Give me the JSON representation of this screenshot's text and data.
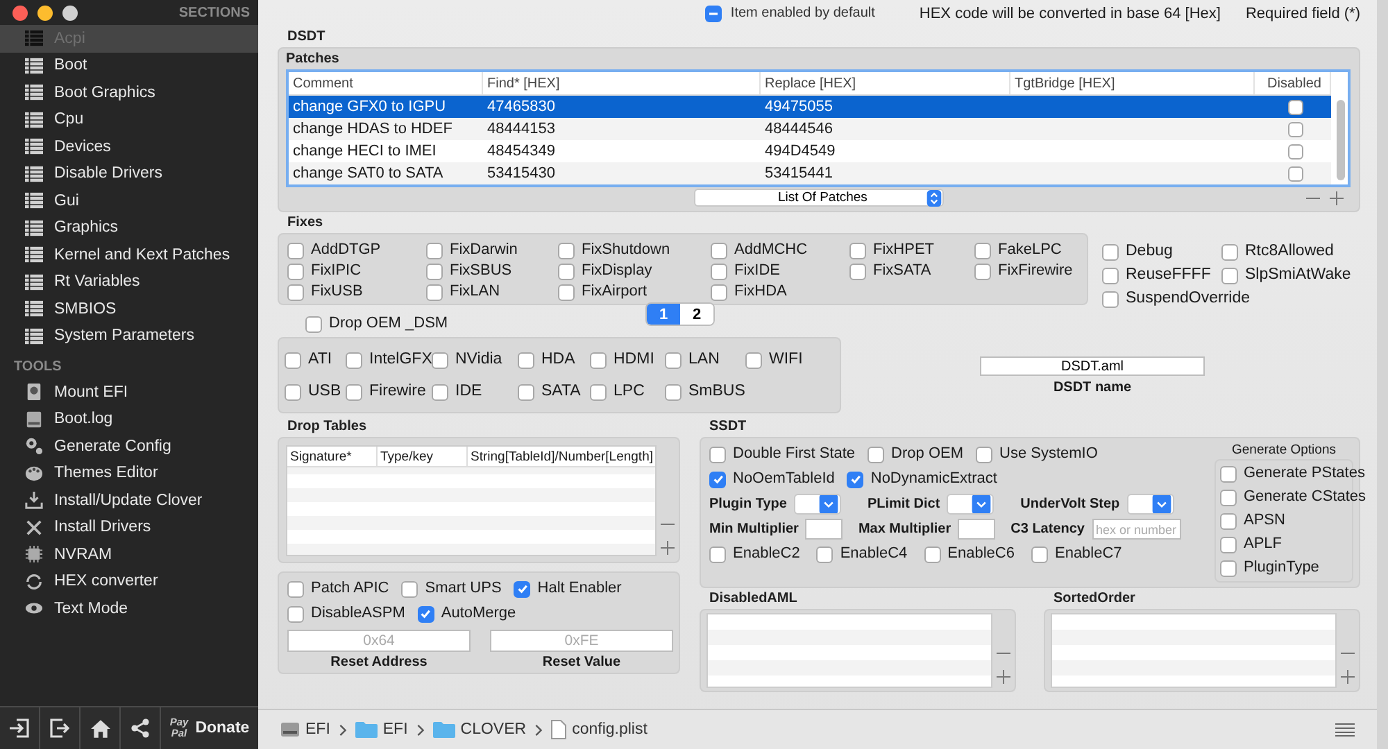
{
  "sidebar": {
    "sections_header": "SECTIONS",
    "sections": [
      {
        "label": "Acpi",
        "selected": true
      },
      {
        "label": "Boot",
        "selected": false
      },
      {
        "label": "Boot Graphics",
        "selected": false
      },
      {
        "label": "Cpu",
        "selected": false
      },
      {
        "label": "Devices",
        "selected": false
      },
      {
        "label": "Disable Drivers",
        "selected": false
      },
      {
        "label": "Gui",
        "selected": false
      },
      {
        "label": "Graphics",
        "selected": false
      },
      {
        "label": "Kernel and Kext Patches",
        "selected": false
      },
      {
        "label": "Rt Variables",
        "selected": false
      },
      {
        "label": "SMBIOS",
        "selected": false
      },
      {
        "label": "System Parameters",
        "selected": false
      }
    ],
    "tools_header": "TOOLS",
    "tools": [
      {
        "label": "Mount EFI"
      },
      {
        "label": "Boot.log"
      },
      {
        "label": "Generate Config"
      },
      {
        "label": "Themes Editor"
      },
      {
        "label": "Install/Update Clover"
      },
      {
        "label": "Install Drivers"
      },
      {
        "label": "NVRAM"
      },
      {
        "label": "HEX converter"
      },
      {
        "label": "Text Mode"
      }
    ],
    "donate": {
      "logo": [
        "Pay",
        "Pal"
      ],
      "label": "Donate"
    }
  },
  "header": {
    "legend": "Item enabled by default",
    "hex_note": "HEX code will be converted in base 64 [Hex]",
    "required_note": "Required field (*)"
  },
  "dsdt": {
    "title": "DSDT",
    "patches": {
      "title": "Patches",
      "columns": [
        "Comment",
        "Find* [HEX]",
        "Replace [HEX]",
        "TgtBridge [HEX]",
        "Disabled"
      ],
      "rows": [
        {
          "comment": "change GFX0 to IGPU",
          "find": "47465830",
          "replace": "49475055",
          "disabled": false,
          "selected": true
        },
        {
          "comment": "change HDAS to HDEF",
          "find": "48444153",
          "replace": "48444546",
          "disabled": false,
          "selected": false
        },
        {
          "comment": "change HECI to IMEI",
          "find": "48454349",
          "replace": "494D4549",
          "disabled": false,
          "selected": false
        },
        {
          "comment": "change SAT0 to SATA",
          "find": "53415430",
          "replace": "53415441",
          "disabled": false,
          "selected": false
        }
      ],
      "dropdown": "List Of Patches"
    },
    "fixes": {
      "title": "Fixes",
      "items": [
        {
          "label": "AddDTGP",
          "checked": false
        },
        {
          "label": "FixDarwin",
          "checked": false
        },
        {
          "label": "FixShutdown",
          "checked": false
        },
        {
          "label": "AddMCHC",
          "checked": false
        },
        {
          "label": "FixHPET",
          "checked": false
        },
        {
          "label": "FakeLPC",
          "checked": false
        },
        {
          "label": "FixIPIC",
          "checked": false
        },
        {
          "label": "FixSBUS",
          "checked": false
        },
        {
          "label": "FixDisplay",
          "checked": false
        },
        {
          "label": "FixIDE",
          "checked": false
        },
        {
          "label": "FixSATA",
          "checked": false
        },
        {
          "label": "FixFirewire",
          "checked": false
        },
        {
          "label": "FixUSB",
          "checked": false
        },
        {
          "label": "FixLAN",
          "checked": false
        },
        {
          "label": "FixAirport",
          "checked": false
        },
        {
          "label": "FixHDA",
          "checked": false
        }
      ],
      "pages": [
        {
          "label": "1",
          "selected": true
        },
        {
          "label": "2",
          "selected": false
        }
      ]
    },
    "options": [
      {
        "label": "Debug",
        "checked": false
      },
      {
        "label": "Rtc8Allowed",
        "checked": false
      },
      {
        "label": "ReuseFFFF",
        "checked": false
      },
      {
        "label": "SlpSmiAtWake",
        "checked": false
      },
      {
        "label": "SuspendOverride",
        "checked": false
      }
    ],
    "drop_oem_dsm": {
      "label": "Drop OEM _DSM",
      "checked": false
    },
    "devices": [
      {
        "label": "ATI",
        "checked": false
      },
      {
        "label": "IntelGFX",
        "checked": false
      },
      {
        "label": "NVidia",
        "checked": false
      },
      {
        "label": "HDA",
        "checked": false
      },
      {
        "label": "HDMI",
        "checked": false
      },
      {
        "label": "LAN",
        "checked": false
      },
      {
        "label": "WIFI",
        "checked": false
      },
      {
        "label": "USB",
        "checked": false
      },
      {
        "label": "Firewire",
        "checked": false
      },
      {
        "label": "IDE",
        "checked": false
      },
      {
        "label": "SATA",
        "checked": false
      },
      {
        "label": "LPC",
        "checked": false
      },
      {
        "label": "SmBUS",
        "checked": false
      }
    ],
    "dsdt_name": {
      "value": "DSDT.aml",
      "label": "DSDT name"
    }
  },
  "drop_tables": {
    "title": "Drop Tables",
    "columns": [
      "Signature*",
      "Type/key",
      "String[TableId]/Number[Length]"
    ]
  },
  "acpi_flags": [
    {
      "label": "Patch APIC",
      "checked": false
    },
    {
      "label": "Smart UPS",
      "checked": false
    },
    {
      "label": "Halt Enabler",
      "checked": true
    },
    {
      "label": "DisableASPM",
      "checked": false
    },
    {
      "label": "AutoMerge",
      "checked": true
    }
  ],
  "reset_address": {
    "placeholder": "0x64",
    "label": "Reset Address"
  },
  "reset_value": {
    "placeholder": "0xFE",
    "label": "Reset Value"
  },
  "ssdt": {
    "title": "SSDT",
    "flags": [
      {
        "label": "Double First State",
        "checked": false
      },
      {
        "label": "Drop OEM",
        "checked": false
      },
      {
        "label": "Use SystemIO",
        "checked": false
      },
      {
        "label": "NoOemTableId",
        "checked": true
      },
      {
        "label": "NoDynamicExtract",
        "checked": true
      }
    ],
    "dropdowns": [
      {
        "label": "Plugin Type"
      },
      {
        "label": "PLimit Dict"
      },
      {
        "label": "UnderVolt Step"
      }
    ],
    "min_multiplier": {
      "label": "Min Multiplier"
    },
    "max_multiplier": {
      "label": "Max Multiplier"
    },
    "c3_latency": {
      "label": "C3 Latency",
      "placeholder": "hex or number"
    },
    "enable": [
      {
        "label": "EnableC2",
        "checked": false
      },
      {
        "label": "EnableC4",
        "checked": false
      },
      {
        "label": "EnableC6",
        "checked": false
      },
      {
        "label": "EnableC7",
        "checked": false
      }
    ],
    "generate_options": {
      "title": "Generate Options",
      "items": [
        {
          "label": "Generate PStates",
          "checked": false
        },
        {
          "label": "Generate CStates",
          "checked": false
        },
        {
          "label": "APSN",
          "checked": false
        },
        {
          "label": "APLF",
          "checked": false
        },
        {
          "label": "PluginType",
          "checked": false
        }
      ]
    }
  },
  "disabled_aml": {
    "title": "DisabledAML"
  },
  "sorted_order": {
    "title": "SortedOrder"
  },
  "path_bar": [
    {
      "label": "EFI",
      "kind": "disk"
    },
    {
      "label": "EFI",
      "kind": "folder"
    },
    {
      "label": "CLOVER",
      "kind": "folder"
    },
    {
      "label": "config.plist",
      "kind": "file"
    }
  ]
}
